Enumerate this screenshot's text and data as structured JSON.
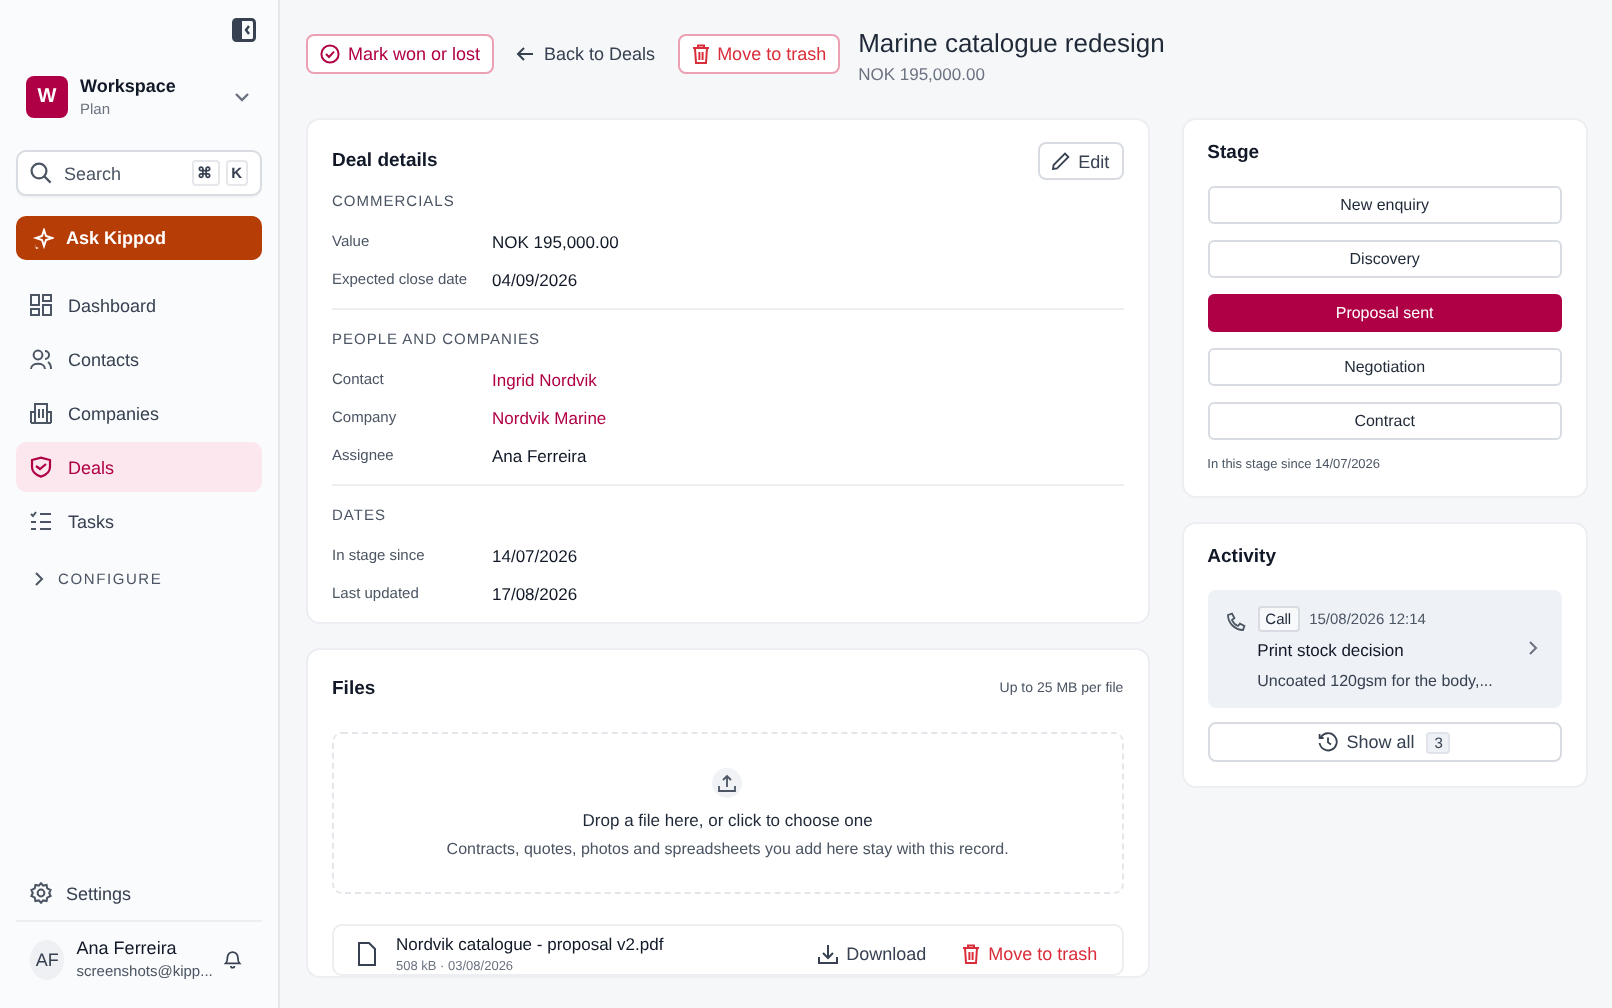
{
  "sidebar": {
    "workspace": {
      "initial": "W",
      "name": "Workspace",
      "plan": "Plan"
    },
    "search": {
      "placeholder": "Search",
      "keys": [
        "⌘",
        "K"
      ]
    },
    "assistant_button": "Ask Kippod",
    "items": [
      {
        "label": "Dashboard",
        "kind": "grid",
        "selected": false
      },
      {
        "label": "Contacts",
        "kind": "people",
        "selected": false
      },
      {
        "label": "Companies",
        "kind": "building",
        "selected": false
      },
      {
        "label": "Deals",
        "kind": "badge",
        "selected": true
      },
      {
        "label": "Tasks",
        "kind": "list",
        "selected": false
      }
    ],
    "configure": {
      "label": "CONFIGURE",
      "expanded": false
    },
    "settings": "Settings",
    "user": {
      "initials": "AF",
      "name": "Ana Ferreira",
      "email": "screenshots@kipp..."
    }
  },
  "header": {
    "mark_button": "Mark won or lost",
    "back_link": "Back to Deals",
    "trash_button": "Move to trash",
    "title": "Marine catalogue redesign",
    "subtitle": "NOK 195,000.00"
  },
  "details": {
    "title": "Deal details",
    "edit_button": "Edit",
    "sections": [
      {
        "heading": "COMMERCIALS",
        "rows": [
          {
            "label": "Value",
            "value": "NOK 195,000.00",
            "kind": "text"
          },
          {
            "label": "Expected close date",
            "value": "04/09/2026",
            "kind": "text"
          }
        ]
      },
      {
        "heading": "PEOPLE AND COMPANIES",
        "rows": [
          {
            "label": "Contact",
            "value": "Ingrid Nordvik",
            "kind": "link"
          },
          {
            "label": "Company",
            "value": "Nordvik Marine",
            "kind": "link"
          },
          {
            "label": "Assignee",
            "value": "Ana Ferreira",
            "kind": "text"
          }
        ]
      },
      {
        "heading": "DATES",
        "rows": [
          {
            "label": "In stage since",
            "value": "14/07/2026",
            "kind": "text"
          },
          {
            "label": "Last updated",
            "value": "17/08/2026",
            "kind": "text"
          }
        ]
      }
    ]
  },
  "files": {
    "title": "Files",
    "limit": "Up to 25 MB per file",
    "dropzone": {
      "title": "Drop a file here, or click to choose one",
      "hint": "Contracts, quotes, photos and spreadsheets you add here stay with this record."
    },
    "items": [
      {
        "name": "Nordvik catalogue - proposal v2.pdf",
        "meta": "508 kB · 03/08/2026",
        "download": "Download",
        "trash": "Move to trash"
      }
    ]
  },
  "stage": {
    "title": "Stage",
    "stages": [
      {
        "label": "New enquiry",
        "selected": false
      },
      {
        "label": "Discovery",
        "selected": false
      },
      {
        "label": "Proposal sent",
        "selected": true
      },
      {
        "label": "Negotiation",
        "selected": false
      },
      {
        "label": "Contract",
        "selected": false
      }
    ],
    "since": "In this stage since 14/07/2026"
  },
  "activity": {
    "title": "Activity",
    "items": [
      {
        "type": "Call",
        "time": "15/08/2026 12:14",
        "title": "Print stock decision",
        "text": "Uncoated 120gsm for the body,..."
      }
    ],
    "show_all": "Show all",
    "count": "3"
  }
}
